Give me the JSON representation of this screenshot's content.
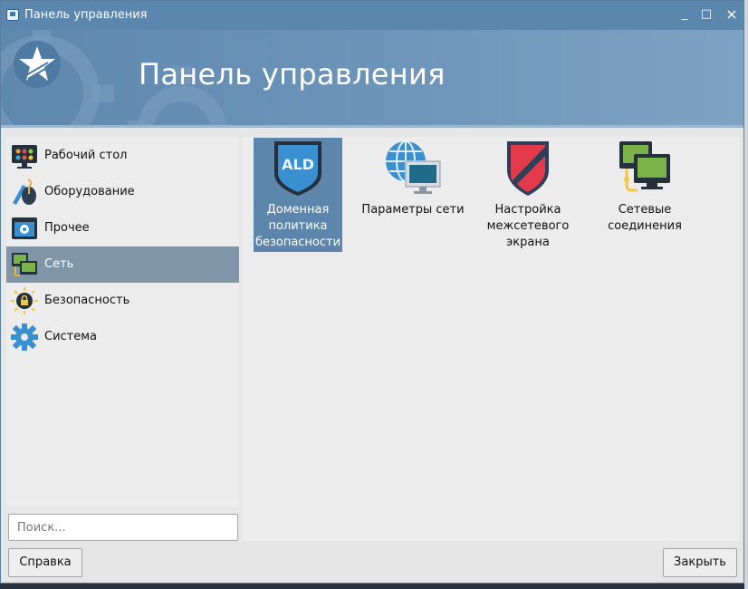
{
  "window": {
    "title": "Панель управления",
    "minimize": "_",
    "maximize": "□",
    "close": "×"
  },
  "banner": {
    "title": "Панель управления"
  },
  "sidebar": {
    "items": [
      {
        "label": "Рабочий стол",
        "icon": "desktop-icon"
      },
      {
        "label": "Оборудование",
        "icon": "hardware-icon"
      },
      {
        "label": "Прочее",
        "icon": "other-icon"
      },
      {
        "label": "Сеть",
        "icon": "network-icon",
        "active": true
      },
      {
        "label": "Безопасность",
        "icon": "security-icon"
      },
      {
        "label": "Система",
        "icon": "system-gear-icon"
      }
    ]
  },
  "content": {
    "tiles": [
      {
        "line1": "Доменная",
        "line2": "политика",
        "line3": "безопасности",
        "icon": "ald-shield-icon",
        "badge": "ALD",
        "selected": true
      },
      {
        "line1": "Параметры сети",
        "line2": "",
        "line3": "",
        "icon": "network-settings-icon"
      },
      {
        "line1": "Настройка",
        "line2": "межсетевого",
        "line3": "экрана",
        "icon": "firewall-shield-icon"
      },
      {
        "line1": "Сетевые",
        "line2": "соединения",
        "line3": "",
        "icon": "network-connections-icon"
      }
    ]
  },
  "search": {
    "placeholder": "Поиск..."
  },
  "buttons": {
    "help": "Справка",
    "close": "Закрыть"
  },
  "colors": {
    "titlebar": "#5b86ad",
    "selection": "#5d86ad",
    "sidebar_active": "#7f96a9"
  }
}
